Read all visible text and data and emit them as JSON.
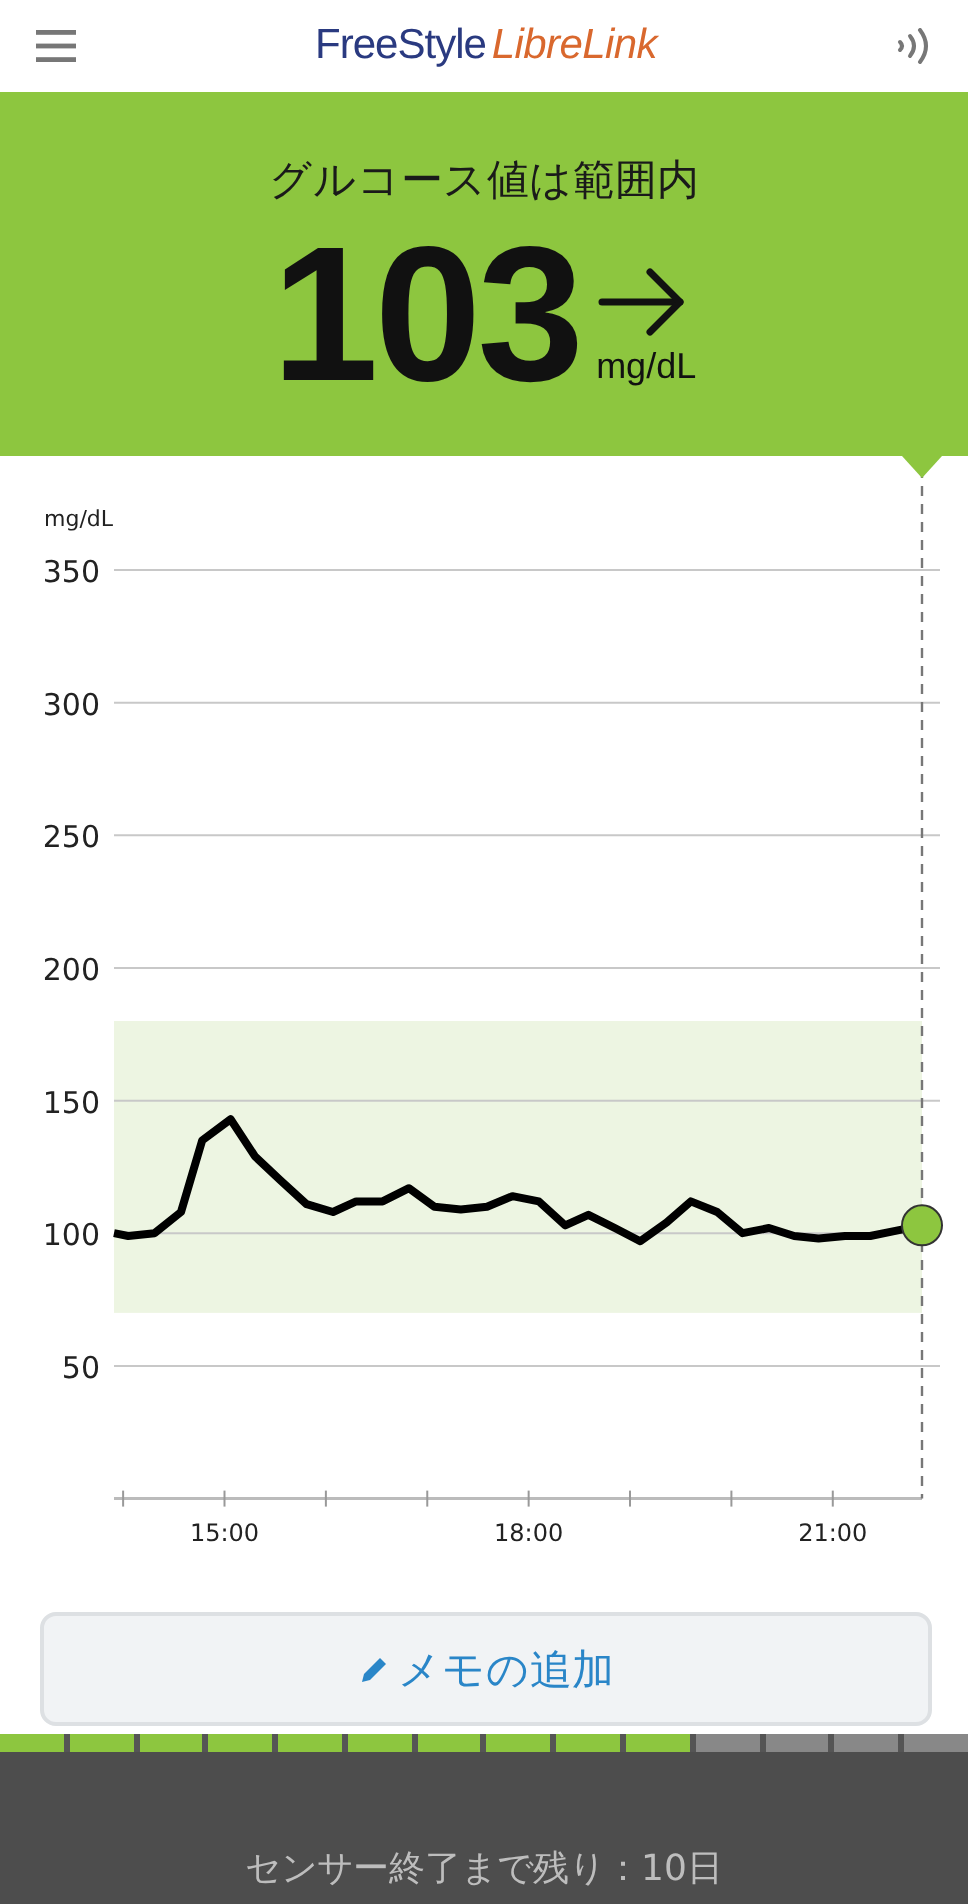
{
  "header": {
    "logo_part_1": "FreeStyle",
    "logo_part_2": "LibreLink"
  },
  "status": {
    "message": "グルコース値は範囲内",
    "value": "103",
    "unit": "mg/dL"
  },
  "chart_data": {
    "type": "line",
    "ylabel": "mg/dL",
    "xlim": [
      13.91,
      21.88
    ],
    "ylim": [
      0,
      350
    ],
    "grid": true,
    "yticks": [
      50,
      100,
      150,
      200,
      250,
      300,
      350
    ],
    "xticks": [
      {
        "value": 15,
        "label": "15:00"
      },
      {
        "value": 18,
        "label": "18:00"
      },
      {
        "value": 21,
        "label": "21:00"
      }
    ],
    "x": [
      13.91,
      14.05,
      14.31,
      14.57,
      14.78,
      15.06,
      15.3,
      15.55,
      15.81,
      16.07,
      16.3,
      16.56,
      16.82,
      17.07,
      17.33,
      17.59,
      17.84,
      18.1,
      18.36,
      18.59,
      18.85,
      19.1,
      19.36,
      19.6,
      19.86,
      20.11,
      20.37,
      20.62,
      20.86,
      21.12,
      21.37,
      21.63,
      21.88
    ],
    "series": [
      {
        "color": "#000000",
        "values": [
          100,
          99,
          100,
          108,
          135,
          143,
          129,
          120,
          111,
          108,
          112,
          112,
          117,
          110,
          109,
          110,
          114,
          112,
          103,
          107,
          102,
          97,
          104,
          112,
          108,
          100,
          102,
          99,
          98,
          99,
          99,
          101,
          103
        ]
      }
    ],
    "bands": [
      {
        "axis": "y",
        "from": 70,
        "to": 180
      }
    ]
  },
  "memo_button": {
    "label": "メモの追加"
  },
  "sensor": {
    "segments": [
      {
        "filled": true
      },
      {
        "filled": true
      },
      {
        "filled": true
      },
      {
        "filled": true
      },
      {
        "filled": true
      },
      {
        "filled": true
      },
      {
        "filled": true
      },
      {
        "filled": true
      },
      {
        "filled": true
      },
      {
        "filled": true
      },
      {
        "filled": false
      },
      {
        "filled": false
      },
      {
        "filled": false
      },
      {
        "filled": false
      }
    ],
    "message": "センサー終了まで残り：10日"
  }
}
